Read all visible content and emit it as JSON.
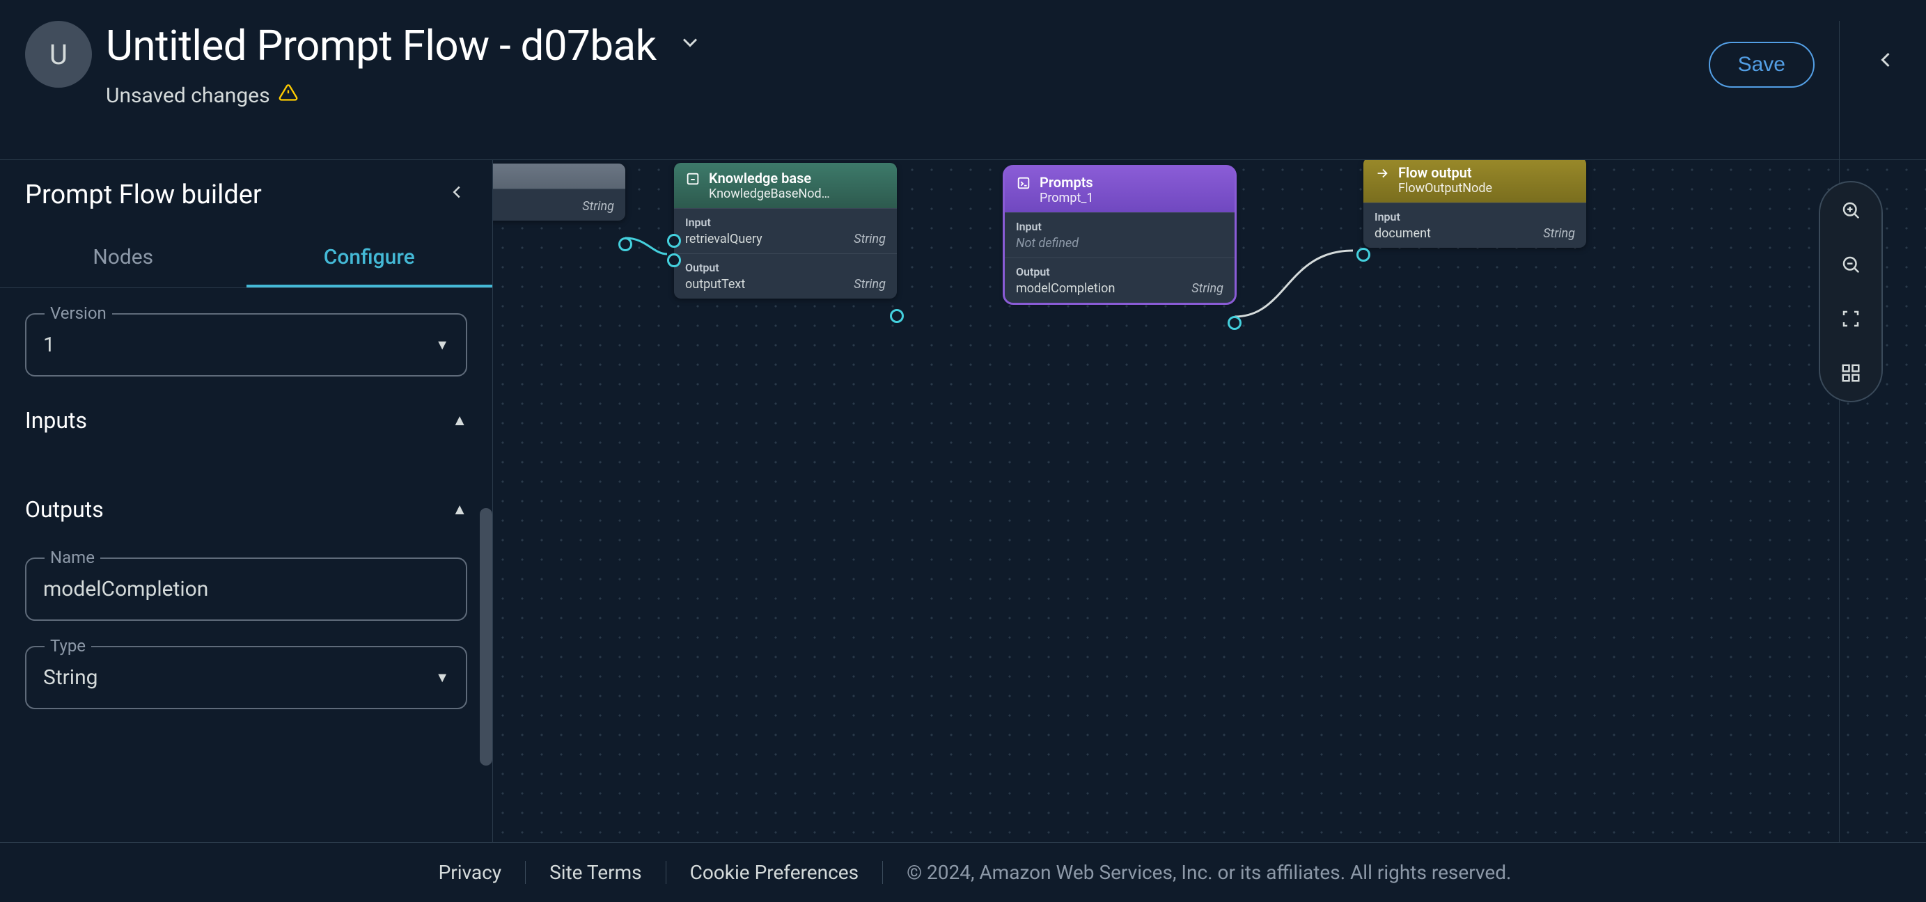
{
  "header": {
    "avatar_initial": "U",
    "title": "Untitled Prompt Flow - d07bak",
    "subtitle": "Unsaved changes",
    "save_label": "Save"
  },
  "sidebar": {
    "title": "Prompt Flow builder",
    "tabs": {
      "nodes": "Nodes",
      "configure": "Configure"
    },
    "version_label": "Version",
    "version_value": "1",
    "inputs_label": "Inputs",
    "outputs_label": "Outputs",
    "output_name_label": "Name",
    "output_name_value": "modelCompletion",
    "output_type_label": "Type",
    "output_type_value": "String"
  },
  "nodes": {
    "input_partial": {
      "row_type": "String"
    },
    "kb": {
      "title": "Knowledge base",
      "subtitle": "KnowledgeBaseNod…",
      "input_label": "Input",
      "input_name": "retrievalQuery",
      "input_type": "String",
      "output_label": "Output",
      "output_name": "outputText",
      "output_type": "String"
    },
    "prompts": {
      "title": "Prompts",
      "subtitle": "Prompt_1",
      "input_label": "Input",
      "input_name": "Not defined",
      "output_label": "Output",
      "output_name": "modelCompletion",
      "output_type": "String"
    },
    "flowout": {
      "title": "Flow output",
      "subtitle": "FlowOutputNode",
      "input_label": "Input",
      "input_name": "document",
      "input_type": "String"
    }
  },
  "footer": {
    "privacy": "Privacy",
    "site_terms": "Site Terms",
    "cookie": "Cookie Preferences",
    "copyright": "© 2024, Amazon Web Services, Inc. or its affiliates. All rights reserved."
  }
}
